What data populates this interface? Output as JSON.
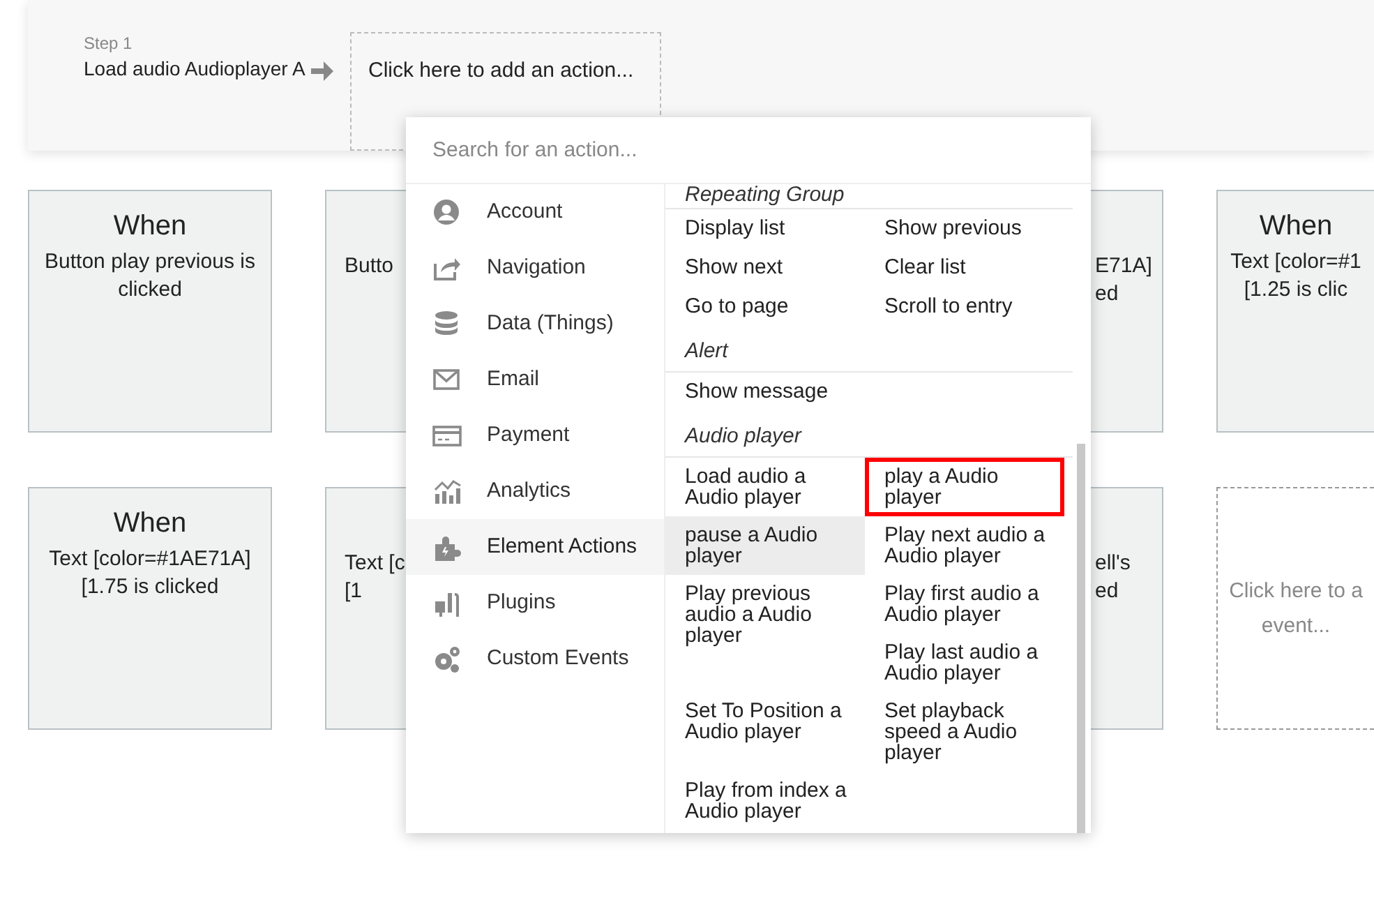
{
  "step": {
    "label": "Step 1",
    "action": "Load audio Audioplayer A"
  },
  "add_action": {
    "label": "Click here to add an action..."
  },
  "event_rows": [
    [
      {
        "kind": "event",
        "title": "When",
        "lines": [
          "Button play previous is",
          "clicked"
        ]
      },
      {
        "kind": "fragment_left",
        "lines": [
          "Butto"
        ]
      },
      {
        "kind": "fragment_right",
        "lines": [
          "E71A]",
          "ed"
        ]
      },
      {
        "kind": "event_edge",
        "title": "When",
        "lines": [
          "Text [color=#1",
          "[1.25 is clic"
        ]
      }
    ],
    [
      {
        "kind": "event",
        "title": "When",
        "lines": [
          "Text [color=#1AE71A]",
          "[1.75 is clicked"
        ]
      },
      {
        "kind": "fragment_left",
        "lines": [
          "Text [c",
          "[1"
        ]
      },
      {
        "kind": "fragment_right",
        "lines": [
          "ell's",
          "ed"
        ]
      },
      {
        "kind": "add",
        "lines": [
          "Click here to a",
          "event..."
        ]
      }
    ]
  ],
  "dropdown": {
    "search": {
      "placeholder": "Search for an action..."
    },
    "categories": [
      {
        "label": "Account",
        "selected": false
      },
      {
        "label": "Navigation",
        "selected": false
      },
      {
        "label": "Data (Things)",
        "selected": false
      },
      {
        "label": "Email",
        "selected": false
      },
      {
        "label": "Payment",
        "selected": false
      },
      {
        "label": "Analytics",
        "selected": false
      },
      {
        "label": "Element Actions",
        "selected": true
      },
      {
        "label": "Plugins",
        "selected": false
      },
      {
        "label": "Custom Events",
        "selected": false
      }
    ],
    "sections": [
      {
        "title": "Repeating Group",
        "items": [
          {
            "label": "Display list",
            "hovered": false,
            "highlighted": false
          },
          {
            "label": "Show previous",
            "hovered": false,
            "highlighted": false
          },
          {
            "label": "Show next",
            "hovered": false,
            "highlighted": false
          },
          {
            "label": "Clear list",
            "hovered": false,
            "highlighted": false
          },
          {
            "label": "Go to page",
            "hovered": false,
            "highlighted": false
          },
          {
            "label": "Scroll to entry",
            "hovered": false,
            "highlighted": false
          }
        ]
      },
      {
        "title": "Alert",
        "items": [
          {
            "label": "Show message",
            "hovered": false,
            "highlighted": false
          }
        ]
      },
      {
        "title": "Audio player",
        "items": [
          {
            "label": "Load audio a Audio player",
            "hovered": false,
            "highlighted": false
          },
          {
            "label": "play a Audio player",
            "hovered": false,
            "highlighted": true
          },
          {
            "label": "pause a Audio player",
            "hovered": true,
            "highlighted": false
          },
          {
            "label": "Play next audio a Audio player",
            "hovered": false,
            "highlighted": false
          },
          {
            "label": "Play previous audio a Audio player",
            "hovered": false,
            "highlighted": false
          },
          {
            "label": "Play first audio a Audio player",
            "hovered": false,
            "highlighted": false
          },
          {
            "label": "Play last audio a Audio player",
            "hovered": false,
            "highlighted": false
          },
          {
            "label": "Set To Position a Audio player",
            "hovered": false,
            "highlighted": false
          },
          {
            "label": "Set playback speed a Audio player",
            "hovered": false,
            "highlighted": false
          },
          {
            "label": "Play from index a Audio player",
            "hovered": false,
            "highlighted": false
          }
        ]
      }
    ]
  }
}
